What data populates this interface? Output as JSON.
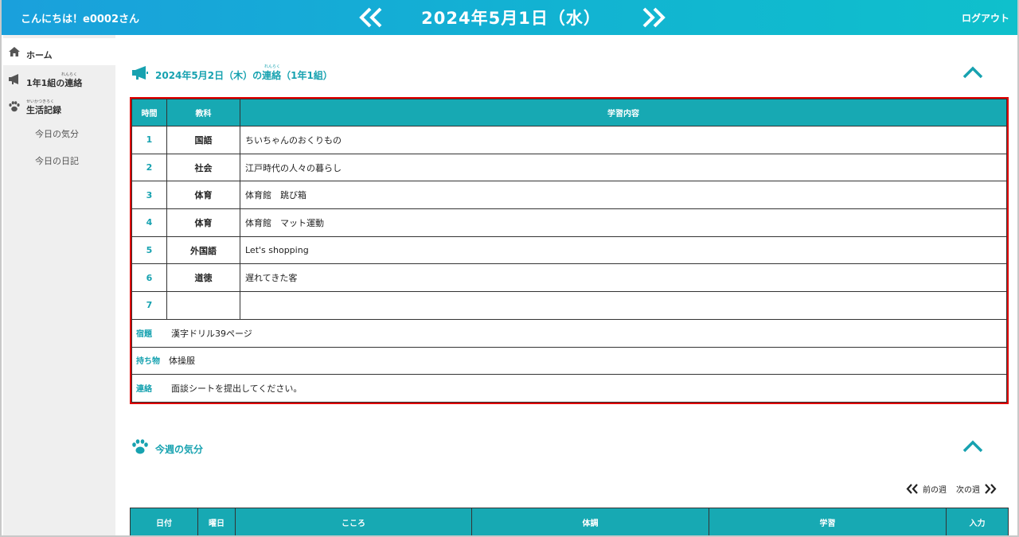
{
  "header": {
    "greeting": "こんにちは！e0002さん",
    "date": "2024年5月1日（水）",
    "logout": "ログアウト"
  },
  "sidebar": {
    "items": [
      {
        "label": "ホーム",
        "icon": "home-icon"
      },
      {
        "label": "1年1組の連絡",
        "ruby": "れんらく",
        "icon": "megaphone-icon"
      },
      {
        "label": "生活記録",
        "ruby": "せいかつきろく",
        "icon": "paw-icon"
      }
    ],
    "subitems": [
      "今日の気分",
      "今日の日記"
    ]
  },
  "notice": {
    "title": "2024年5月2日（木）の連絡（1年1組）",
    "title_ruby": "れんらく",
    "columns": [
      "時間",
      "教科",
      "学習内容"
    ],
    "rows": [
      {
        "period": "1",
        "subject": "国語",
        "content": "ちいちゃんのおくりもの"
      },
      {
        "period": "2",
        "subject": "社会",
        "content": "江戸時代の人々の暮らし"
      },
      {
        "period": "3",
        "subject": "体育",
        "content": "体育館　跳び箱"
      },
      {
        "period": "4",
        "subject": "体育",
        "content": "体育館　マット運動"
      },
      {
        "period": "5",
        "subject": "外国語",
        "content": "Let's shopping"
      },
      {
        "period": "6",
        "subject": "道徳",
        "content": "遅れてきた客"
      },
      {
        "period": "7",
        "subject": "",
        "content": ""
      }
    ],
    "extras": [
      {
        "label": "宿題",
        "value": "漢字ドリル39ページ"
      },
      {
        "label": "持ち物",
        "value": "体操服"
      },
      {
        "label": "連絡",
        "value": "面談シートを提出してください。"
      }
    ]
  },
  "mood": {
    "title": "今週の気分",
    "prev_week": "前の週",
    "next_week": "次の週",
    "columns": [
      "日付",
      "曜日",
      "こころ",
      "体調",
      "学習",
      "入力"
    ]
  },
  "colors": {
    "accent": "#17a2b0",
    "header_start": "#1aa0dc",
    "header_end": "#0fc0cc",
    "highlight_border": "#e00000"
  }
}
